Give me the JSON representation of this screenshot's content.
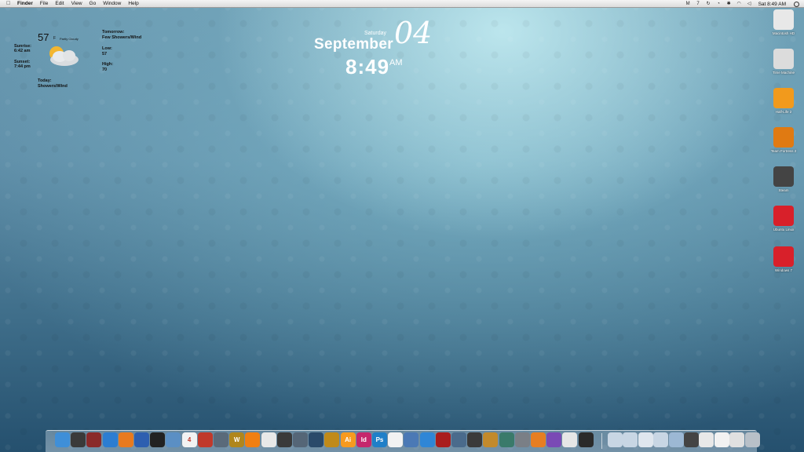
{
  "menubar": {
    "items": [
      "Finder",
      "File",
      "Edit",
      "View",
      "Go",
      "Window",
      "Help"
    ],
    "status_glyph": "7",
    "clock": "Sat 8:49 AM"
  },
  "weather": {
    "temp": "57",
    "unit": "F",
    "condition": "Partly Cloudy",
    "sunrise_label": "Sunrise:",
    "sunrise": "6:42 am",
    "sunset_label": "Sunset:",
    "sunset": "7:44 pm",
    "today_label": "Today:",
    "today": "Showers/Wind",
    "tomorrow_label": "Tomorrow:",
    "tomorrow": "Few Showers/Wind",
    "low_label": "Low:",
    "low": "57",
    "high_label": "High:",
    "high": "70"
  },
  "date": {
    "weekday": "Saturday",
    "month": "September",
    "day": "04",
    "time": "8:49",
    "ampm": "AM"
  },
  "desktop_icons": [
    {
      "label": "Macintosh HD",
      "icon": "hard-drive-icon",
      "color": "#e8e8e8"
    },
    {
      "label": "Time Machine",
      "icon": "time-machine-icon",
      "color": "#dcdcdc"
    },
    {
      "label": "Half-Life 2",
      "icon": "half-life-icon",
      "color": "#f29a1c"
    },
    {
      "label": "Team Fortress 2",
      "icon": "team-fortress-icon",
      "color": "#e07a12"
    },
    {
      "label": "Steam",
      "icon": "steam-icon",
      "color": "#444444"
    },
    {
      "label": "Ubuntu Linux",
      "icon": "parallels-vm-icon",
      "color": "#d8202a"
    },
    {
      "label": "Windows 7",
      "icon": "parallels-vm-icon",
      "color": "#d8202a"
    }
  ],
  "dock": {
    "apps": [
      {
        "name": "finder",
        "color": "#3f8fd8",
        "glyph": ""
      },
      {
        "name": "dashboard",
        "color": "#3a3a3a",
        "glyph": ""
      },
      {
        "name": "photo-booth",
        "color": "#8a2a2a",
        "glyph": ""
      },
      {
        "name": "safari",
        "color": "#2c7dd1",
        "glyph": ""
      },
      {
        "name": "firefox",
        "color": "#e87a1f",
        "glyph": ""
      },
      {
        "name": "google-earth",
        "color": "#2e5fb0",
        "glyph": ""
      },
      {
        "name": "camera",
        "color": "#222222",
        "glyph": ""
      },
      {
        "name": "preview",
        "color": "#5b8fc4",
        "glyph": ""
      },
      {
        "name": "calendar",
        "color": "#f2f2f2",
        "glyph": "4"
      },
      {
        "name": "photos",
        "color": "#c0392b",
        "glyph": ""
      },
      {
        "name": "utility",
        "color": "#5a6a7a",
        "glyph": ""
      },
      {
        "name": "warcraft",
        "color": "#b0861c",
        "glyph": "W"
      },
      {
        "name": "vlc",
        "color": "#f07f12",
        "glyph": ""
      },
      {
        "name": "penguin",
        "color": "#e8e8e8",
        "glyph": ""
      },
      {
        "name": "steam",
        "color": "#3a3a3a",
        "glyph": ""
      },
      {
        "name": "dock-app-16",
        "color": "#556677",
        "glyph": ""
      },
      {
        "name": "portal",
        "color": "#2a4a6a",
        "glyph": ""
      },
      {
        "name": "dock-app-18",
        "color": "#c08a1a",
        "glyph": ""
      },
      {
        "name": "illustrator",
        "color": "#f79a1e",
        "glyph": "Ai"
      },
      {
        "name": "indesign",
        "color": "#c5276c",
        "glyph": "Id"
      },
      {
        "name": "photoshop",
        "color": "#1f7fc8",
        "glyph": "Ps"
      },
      {
        "name": "acrobat",
        "color": "#f2f2f2",
        "glyph": ""
      },
      {
        "name": "itunes-mix",
        "color": "#4b79b5",
        "glyph": ""
      },
      {
        "name": "app-store",
        "color": "#2f86d6",
        "glyph": ""
      },
      {
        "name": "photo-red",
        "color": "#a91d1d",
        "glyph": ""
      },
      {
        "name": "iphoto",
        "color": "#4a6b8c",
        "glyph": ""
      },
      {
        "name": "imovie",
        "color": "#3a3a3a",
        "glyph": ""
      },
      {
        "name": "garageband",
        "color": "#c28a2c",
        "glyph": ""
      },
      {
        "name": "time-machine",
        "color": "#3a7a6a",
        "glyph": ""
      },
      {
        "name": "system-preferences",
        "color": "#7a7f86",
        "glyph": ""
      },
      {
        "name": "vlc-2",
        "color": "#e67e22",
        "glyph": ""
      },
      {
        "name": "visual-studio",
        "color": "#7a4ab5",
        "glyph": ""
      },
      {
        "name": "textedit",
        "color": "#e6e6e6",
        "glyph": ""
      },
      {
        "name": "terminal",
        "color": "#2a2a2a",
        "glyph": ""
      }
    ],
    "stacks": [
      {
        "name": "applications-folder",
        "color": "#c8d6e4"
      },
      {
        "name": "documents-folder",
        "color": "#c8d6e4"
      },
      {
        "name": "downloads-folder",
        "color": "#dfe6ee"
      },
      {
        "name": "folder-4",
        "color": "#c8d6e4"
      },
      {
        "name": "folder-5",
        "color": "#9cb8d4"
      },
      {
        "name": "folder-6",
        "color": "#444444"
      },
      {
        "name": "folder-7",
        "color": "#e8e8e8"
      },
      {
        "name": "document-stack",
        "color": "#f2f2f2"
      },
      {
        "name": "file-stack",
        "color": "#e0e0e0"
      },
      {
        "name": "trash",
        "color": "#b8c0c8"
      }
    ]
  }
}
